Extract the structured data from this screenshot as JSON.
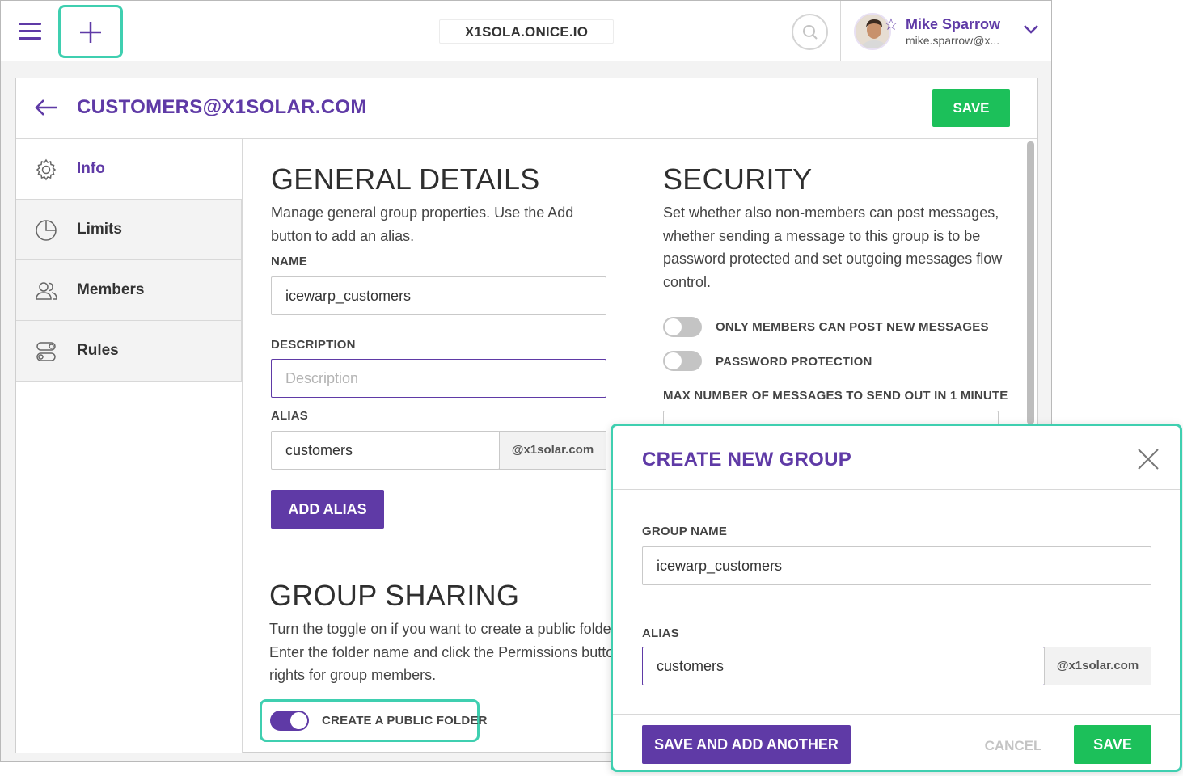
{
  "topbar": {
    "server_name": "X1SOLA.ONICE.IO",
    "user": {
      "name": "Mike Sparrow",
      "email": "mike.sparrow@x..."
    },
    "icons": [
      "menu-icon",
      "plus-icon",
      "search-icon",
      "star-icon",
      "chevron-down-icon"
    ]
  },
  "header": {
    "title": "CUSTOMERS@X1SOLAR.COM",
    "save_label": "SAVE"
  },
  "sidebar": {
    "items": [
      {
        "label": "Info",
        "icon": "gear-icon",
        "active": true
      },
      {
        "label": "Limits",
        "icon": "pie-chart-icon",
        "active": false
      },
      {
        "label": "Members",
        "icon": "users-icon",
        "active": false
      },
      {
        "label": "Rules",
        "icon": "rules-icon",
        "active": false
      }
    ]
  },
  "general": {
    "title": "GENERAL DETAILS",
    "description": "Manage general group properties. Use the Add button to add an alias.",
    "name_label": "NAME",
    "name_value": "icewarp_customers",
    "description_label": "DESCRIPTION",
    "description_placeholder": "Description",
    "alias_label": "ALIAS",
    "alias_value": "customers",
    "alias_domain": "@x1solar.com",
    "add_alias_label": "ADD ALIAS"
  },
  "security": {
    "title": "SECURITY",
    "description": "Set whether also non-members can post messages, whether sending a message to this group is to be password protected and set outgoing messages flow control.",
    "toggle_members_only": {
      "label": "ONLY MEMBERS CAN POST NEW MESSAGES",
      "on": false
    },
    "toggle_password": {
      "label": "PASSWORD PROTECTION",
      "on": false
    },
    "max_messages_label": "MAX NUMBER OF MESSAGES TO SEND OUT IN 1 MINUTE"
  },
  "sharing": {
    "title": "GROUP SHARING",
    "description_lines": [
      "Turn the toggle on if you want to create a public folder",
      "Enter the folder name and click the Permissions button",
      "rights for group members."
    ],
    "toggle_public_folder": {
      "label": "CREATE A PUBLIC FOLDER",
      "on": true
    }
  },
  "dialog": {
    "title": "CREATE NEW GROUP",
    "group_name_label": "GROUP NAME",
    "group_name_value": "icewarp_customers",
    "alias_label": "ALIAS",
    "alias_value": "customers",
    "alias_domain": "@x1solar.com",
    "save_and_add_label": "SAVE AND ADD ANOTHER",
    "cancel_label": "CANCEL",
    "save_label": "SAVE"
  },
  "colors": {
    "accent": "#5f3aa6",
    "success": "#1cc05a",
    "highlight": "#3fcfb0"
  }
}
